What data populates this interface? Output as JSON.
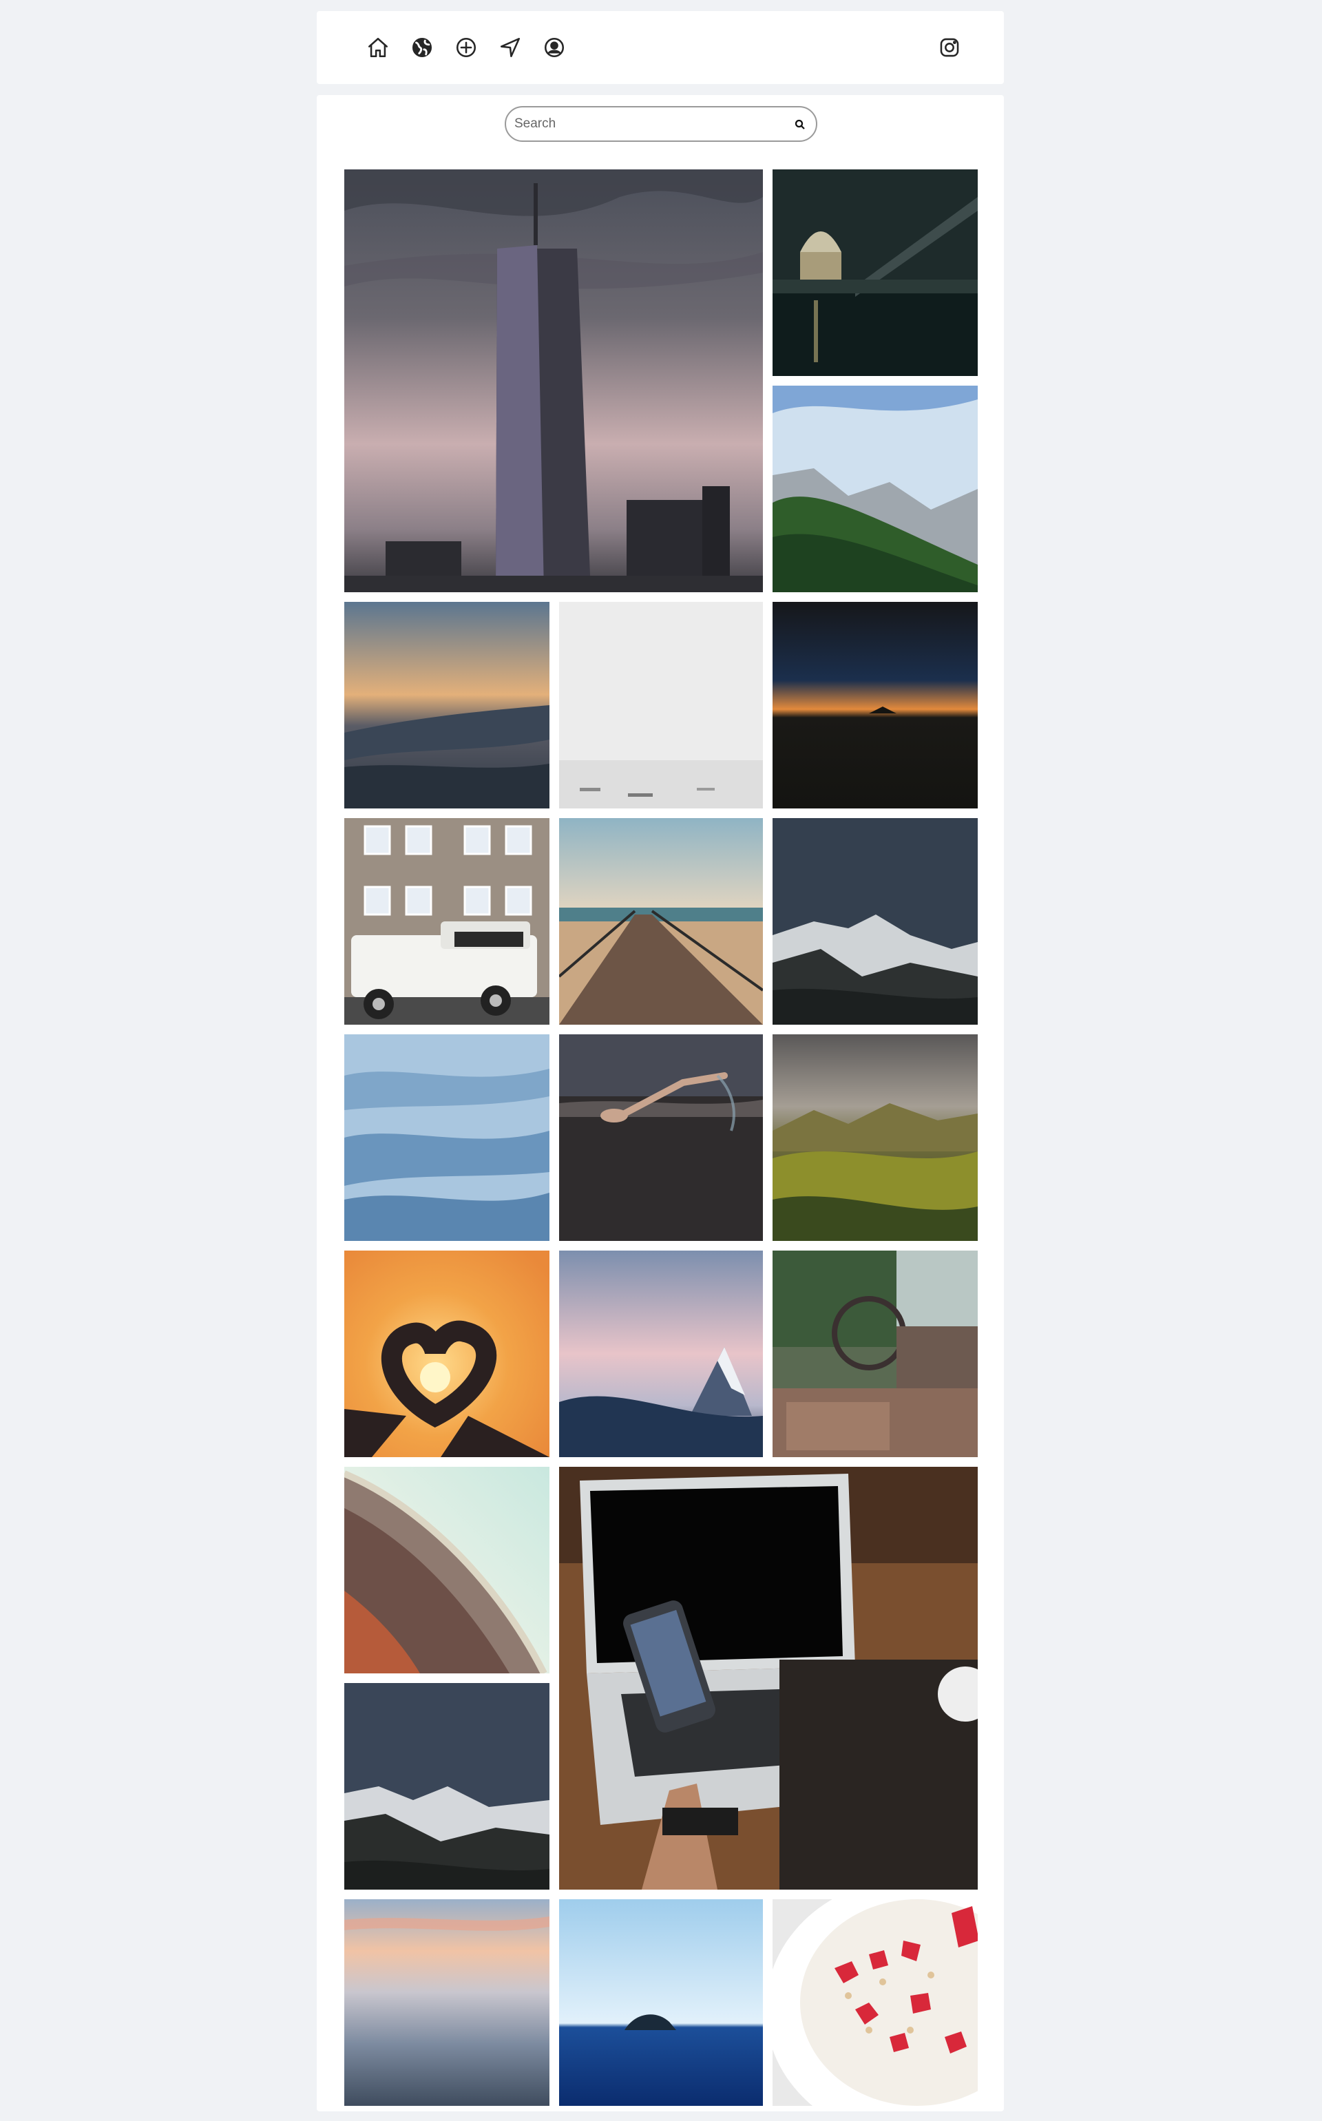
{
  "header": {
    "nav_icons": [
      "home-icon",
      "globe-icon",
      "add-circle-icon",
      "navigation-arrow-icon",
      "profile-icon"
    ],
    "right_icon": "instagram-icon"
  },
  "search": {
    "placeholder": "Search",
    "value": "",
    "button_icon": "search-icon"
  },
  "gallery": {
    "photos": [
      "skyscraper-at-dusk",
      "city-bridge-at-night",
      "green-mountain-valley",
      "ocean-wave-sunset",
      "foggy-sea-boats",
      "dark-horizon-glow",
      "white-suv-by-building",
      "wooden-pier",
      "snowy-mountain-night",
      "blue-mountain-layers",
      "swimmer-in-lake",
      "green-valley-storm",
      "heart-hands-sunset",
      "snowy-peak-pink-sky",
      "abandoned-vehicle-interior",
      "curved-roof-architecture",
      "snowy-mountains-dusk",
      "laptop-and-phone",
      "pastel-sea-sunset",
      "blue-sea-island",
      "strawberry-yogurt-bowl"
    ]
  },
  "colors": {
    "page_background": "#f0f2f5",
    "card_background": "#ffffff",
    "icon_stroke": "#262626"
  }
}
